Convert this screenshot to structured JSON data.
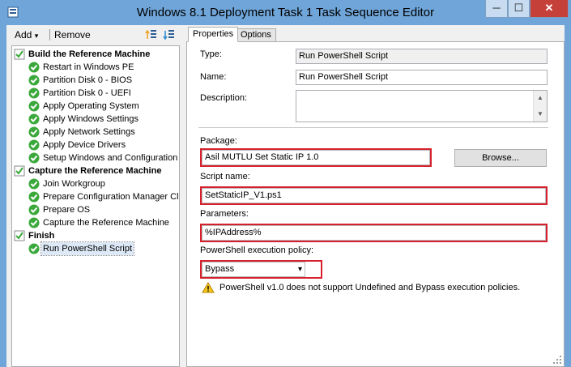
{
  "window": {
    "title": "Windows 8.1 Deployment Task 1 Task Sequence Editor",
    "min_glyph": "─",
    "max_glyph": "☐",
    "close_glyph": "✕"
  },
  "toolbar": {
    "add_label": "Add",
    "add_arrow": "▾",
    "remove_label": "Remove"
  },
  "tree": {
    "groups": [
      {
        "label": "Build the Reference Machine",
        "steps": [
          "Restart in Windows PE",
          "Partition Disk 0 - BIOS",
          "Partition Disk 0 - UEFI",
          "Apply Operating System",
          "Apply Windows Settings",
          "Apply Network Settings",
          "Apply Device Drivers",
          "Setup Windows and Configuration"
        ]
      },
      {
        "label": "Capture the Reference Machine",
        "steps": [
          "Join Workgroup",
          "Prepare Configuration Manager Cli",
          "Prepare OS",
          "Capture the Reference Machine"
        ]
      },
      {
        "label": "Finish",
        "steps": [
          "Run PowerShell Script"
        ]
      }
    ],
    "selected_step": "Run PowerShell Script"
  },
  "tabs": [
    {
      "label": "Properties",
      "active": true
    },
    {
      "label": "Options",
      "active": false
    }
  ],
  "properties": {
    "type_label": "Type:",
    "type_value": "Run PowerShell Script",
    "name_label": "Name:",
    "name_value": "Run PowerShell Script",
    "description_label": "Description:",
    "description_value": "",
    "package_label": "Package:",
    "package_value": "Asil MUTLU Set Static IP 1.0",
    "browse_label": "Browse...",
    "script_name_label": "Script name:",
    "script_name_value": "SetStaticIP_V1.ps1",
    "parameters_label": "Parameters:",
    "parameters_value": "%IPAddress%",
    "policy_label": "PowerShell execution policy:",
    "policy_value": "Bypass",
    "policy_arrow": "▾",
    "warning_text": "PowerShell v1.0 does not support Undefined and Bypass execution policies."
  },
  "colors": {
    "highlight": "#d6212c",
    "titlebar": "#6fa5d8",
    "close_button": "#c6403a",
    "step_ok": "#3aa83a"
  },
  "icons": {
    "app": "task-sequence-icon",
    "group": "folder-check-icon",
    "step": "green-check-icon",
    "warning": "warning-triangle-icon"
  }
}
